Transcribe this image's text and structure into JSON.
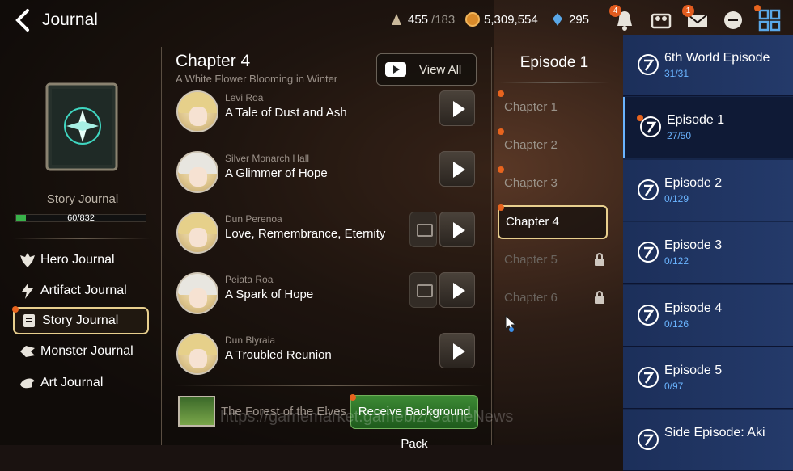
{
  "header": {
    "title": "Journal",
    "stamina": "455",
    "stamina_max": "/183",
    "gold": "5,309,554",
    "crystal": "295",
    "bell_badge": "4",
    "mail_badge": "1"
  },
  "left": {
    "book_label": "Story Journal",
    "progress_text": "60/832",
    "progress": 0.072,
    "nav": [
      {
        "label": "Hero Journal",
        "icon": "hero-icon"
      },
      {
        "label": "Artifact Journal",
        "icon": "artifact-icon"
      },
      {
        "label": "Story Journal",
        "icon": "story-icon",
        "active": true
      },
      {
        "label": "Monster Journal",
        "icon": "monster-icon"
      },
      {
        "label": "Art Journal",
        "icon": "art-icon"
      }
    ]
  },
  "chapter": {
    "title": "Chapter 4",
    "subtitle": "A White Flower Blooming in Winter",
    "view_all": "View All",
    "stories": [
      {
        "name": "Levi Roa",
        "title": "A Tale of Dust and Ash",
        "image": false
      },
      {
        "name": "Silver Monarch Hall",
        "title": "A Glimmer of Hope",
        "image": false
      },
      {
        "name": "Dun Perenoa",
        "title": "Love, Remembrance, Eternity",
        "image": true
      },
      {
        "name": "Peiata Roa",
        "title": "A Spark of Hope",
        "image": true
      },
      {
        "name": "Dun Blyraia",
        "title": "A Troubled Reunion",
        "image": false
      }
    ],
    "reward_label": "The Forest of the Elves",
    "receive_label": "Receive Background Pack",
    "watermark": "https://gamemarket.gamebiz/GameNews"
  },
  "episode": {
    "title": "Episode 1",
    "chapters": [
      {
        "label": "Chapter 1",
        "locked": false
      },
      {
        "label": "Chapter 2",
        "locked": false
      },
      {
        "label": "Chapter 3",
        "locked": false
      },
      {
        "label": "Chapter 4",
        "locked": false,
        "active": true
      },
      {
        "label": "Chapter 5",
        "locked": true
      },
      {
        "label": "Chapter 6",
        "locked": true
      }
    ]
  },
  "episodes": [
    {
      "name": "6th World Episode",
      "count": "31/31"
    },
    {
      "name": "Episode 1",
      "count": "27/50",
      "active": true
    },
    {
      "name": "Episode 2",
      "count": "0/129"
    },
    {
      "name": "Episode 3",
      "count": "0/122"
    },
    {
      "name": "Episode 4",
      "count": "0/126"
    },
    {
      "name": "Episode 5",
      "count": "0/97"
    },
    {
      "name": "Side Episode: Aki",
      "count": ""
    }
  ],
  "colors": {
    "accent": "#e8cf8e",
    "notify": "#e8641e",
    "episode_count": "#6ab4ff",
    "receive_button": "#3c8a34"
  }
}
